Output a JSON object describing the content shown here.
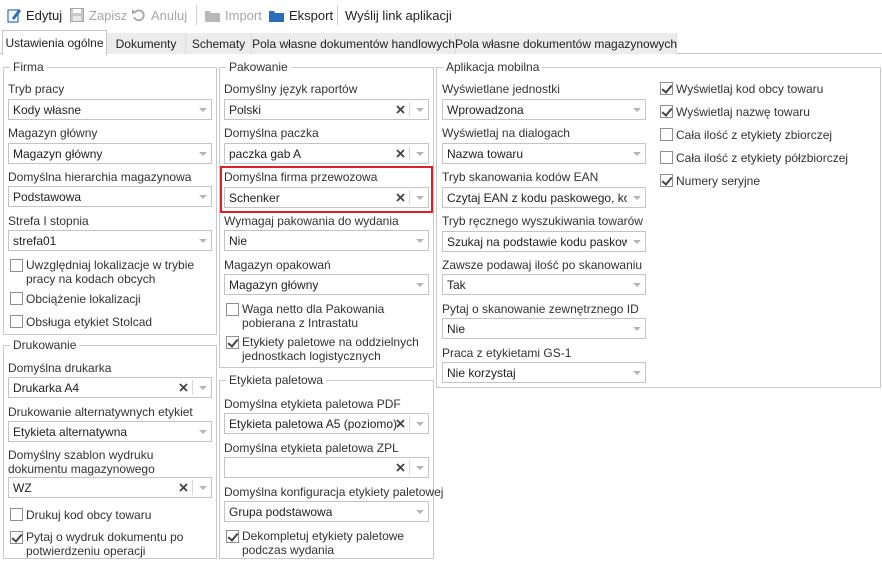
{
  "toolbar": {
    "edit": "Edytuj",
    "save": "Zapisz",
    "cancel": "Anuluj",
    "import": "Import",
    "export": "Eksport",
    "send_link": "Wyślij link aplikacji"
  },
  "tabs": [
    "Ustawienia ogólne",
    "Dokumenty",
    "Schematy",
    "Pola własne dokumentów handlowych",
    "Pola własne dokumentów magazynowych"
  ],
  "firma": {
    "title": "Firma",
    "tryb_pracy_label": "Tryb pracy",
    "tryb_pracy_value": "Kody własne",
    "magazyn_glowny_label": "Magazyn główny",
    "magazyn_glowny_value": "Magazyn główny",
    "hierarchia_label": "Domyślna hierarchia magazynowa",
    "hierarchia_value": "Podstawowa",
    "strefa_label": "Strefa I stopnia",
    "strefa_value": "strefa01",
    "cb_lokalizacje": "Uwzględniaj lokalizacje w trybie pracy na kodach obcych",
    "cb_obciazenie": "Obciążenie lokalizacji",
    "cb_stolcad": "Obsługa etykiet Stolcad"
  },
  "drukowanie": {
    "title": "Drukowanie",
    "drukarka_label": "Domyślna drukarka",
    "drukarka_value": "Drukarka A4",
    "alt_label": "Drukowanie alternatywnych etykiet",
    "alt_value": "Etykieta alternatywna",
    "szablon_label": "Domyślny szablon wydruku dokumentu magazynowego",
    "szablon_value": "WZ",
    "cb_kod_obcy": "Drukuj kod obcy towaru",
    "cb_pytaj": "Pytaj o wydruk dokumentu po potwierdzeniu operacji"
  },
  "pakowanie": {
    "title": "Pakowanie",
    "jezyk_label": "Domyślny język raportów",
    "jezyk_value": "Polski",
    "paczka_label": "Domyślna paczka",
    "paczka_value": "paczka gab A",
    "firma_label": "Domyślna firma przewozowa",
    "firma_value": "Schenker",
    "wymagaj_label": "Wymagaj pakowania do wydania",
    "wymagaj_value": "Nie",
    "opakowan_label": "Magazyn opakowań",
    "opakowan_value": "Magazyn główny",
    "cb_waga": "Waga netto dla Pakowania pobierana z Intrastatu",
    "cb_etykiety": "Etykiety paletowe na oddzielnych jednostkach logistycznych"
  },
  "etykieta": {
    "title": "Etykieta paletowa",
    "pdf_label": "Domyślna etykieta paletowa PDF",
    "pdf_value": "Etykieta paletowa A5 (poziomo)",
    "zpl_label": "Domyślna etykieta paletowa ZPL",
    "zpl_value": "",
    "konf_label": "Domyślna konfiguracja etykiety paletowej",
    "konf_value": "Grupa podstawowa",
    "cb_dekompletuj": "Dekompletuj etykiety paletowe podczas wydania"
  },
  "mobilna": {
    "title": "Aplikacja mobilna",
    "jednostki_label": "Wyświetlane jednostki",
    "jednostki_value": "Wprowadzona",
    "dialogi_label": "Wyświetlaj na dialogach",
    "dialogi_value": "Nazwa towaru",
    "ean_label": "Tryb skanowania kodów EAN",
    "ean_value": "Czytaj EAN z kodu paskowego, kod...",
    "reczny_label": "Tryb ręcznego wyszukiwania towarów",
    "reczny_value": "Szukaj na podstawie kodu paskowe...",
    "ilosc_label": "Zawsze podawaj ilość po skanowaniu",
    "ilosc_value": "Tak",
    "zewn_label": "Pytaj o skanowanie zewnętrznego ID",
    "zewn_value": "Nie",
    "gs1_label": "Praca z etykietami GS-1",
    "gs1_value": "Nie korzystaj",
    "cb_kod_obcy": "Wyświetlaj kod obcy towaru",
    "cb_nazwa": "Wyświetlaj nazwę towaru",
    "cb_zbiorcze": "Cała ilość z etykiety zbiorczej",
    "cb_polzbiorcze": "Cała ilość z etykiety półzbiorczej",
    "cb_seryjne": "Numery seryjne"
  },
  "state": {
    "firma_lokalizacje": false,
    "firma_obciazenie": false,
    "firma_stolcad": false,
    "druk_kod_obcy": false,
    "druk_pytaj": true,
    "pak_waga": false,
    "pak_etykiety": true,
    "ety_dekompletuj": true,
    "mob_kod_obcy": true,
    "mob_nazwa": true,
    "mob_zbiorcze": false,
    "mob_polzbiorcze": false,
    "mob_seryjne": true
  },
  "colors": {
    "highlight": "#d9222a",
    "accent": "#2a6ebb"
  },
  "icons": {
    "edit": "edit-icon",
    "save": "save-icon",
    "cancel": "undo-icon",
    "import": "folder-icon",
    "export": "folder-icon"
  }
}
